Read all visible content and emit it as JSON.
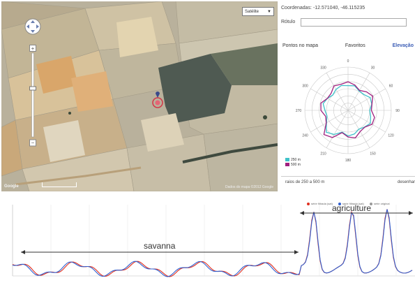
{
  "map": {
    "map_type_label": "Satélite",
    "logo": "Google",
    "attribution": "Dados do mapa ©2012 Google"
  },
  "info": {
    "coords_label": "Coordenadas:",
    "coords_value": "-12.571040, -46.115235",
    "rotulo_label": "Rótulo"
  },
  "tabs": {
    "points": "Pontos no mapa",
    "favorites": "Favoritos",
    "elevation": "Elevação"
  },
  "polar": {
    "angle_labels": [
      "0",
      "30",
      "60",
      "90",
      "120",
      "150",
      "180",
      "210",
      "240",
      "270",
      "300",
      "330"
    ],
    "legend": [
      {
        "label": "250 m",
        "color": "#3fc2c9"
      },
      {
        "label": "500 m",
        "color": "#a0207f"
      }
    ]
  },
  "bottom": {
    "range_text": "raios de 250 a 500 m",
    "draw_link": "desenhar"
  },
  "profile": {
    "legend": [
      {
        "label": "série filtrada (sat)",
        "color": "#e03020"
      },
      {
        "label": "série filtrada (sat)",
        "color": "#3060d0"
      },
      {
        "label": "série original",
        "color": "#999999"
      }
    ],
    "annotations": {
      "savanna": "savanna",
      "agriculture": "agriculture"
    }
  },
  "colors": {
    "series_red": "#e03020",
    "series_blue": "#3060d0",
    "radar_teal": "#3fc2c9",
    "radar_purple": "#a0207f"
  }
}
